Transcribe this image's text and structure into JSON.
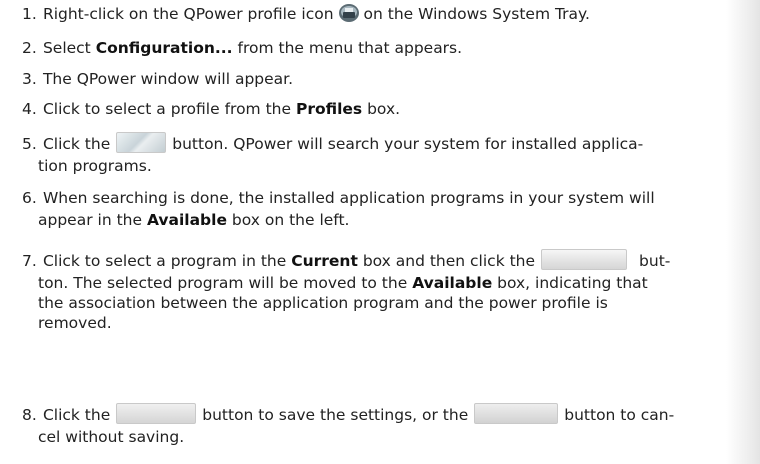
{
  "steps": [
    {
      "number": "1.",
      "before": "Right-click on the QPower profile icon",
      "after": "on the Windows System Tray.",
      "icon": "qpower-tray-icon"
    },
    {
      "number": "2.",
      "before": "Select",
      "bold": "Configuration...",
      "after": "from the menu that appears."
    },
    {
      "number": "3.",
      "text": "The QPower window will appear."
    },
    {
      "number": "4.",
      "before": "Click to select a profile from the",
      "bold": "Profiles",
      "after": "box."
    },
    {
      "number": "5.",
      "before": "Click the",
      "after": "button. QPower will search your system for installed applica-",
      "line2": "tion programs.",
      "icon": "search-button-icon"
    },
    {
      "number": "6.",
      "line1": "When searching is done, the installed application programs in your system will",
      "line2_before": "appear in the",
      "line2_bold": "Available",
      "line2_after": "box on the left."
    },
    {
      "number": "7.",
      "line1_before": "Click to select a program in the",
      "line1_bold": "Current",
      "line1_mid": "box and then click the",
      "line1_after": "but-",
      "line2_before": "ton. The selected program will be moved to the",
      "line2_bold": "Available",
      "line2_after": "box, indicating that",
      "line3": "the association between the application program and the power profile is",
      "line4": "removed.",
      "icon": "remove-button-icon"
    },
    {
      "number": "8.",
      "before": "Click the",
      "mid": "button to save the settings, or the",
      "after": "button to can-",
      "line2": "cel without saving.",
      "icons": [
        "ok-button-icon",
        "cancel-button-icon"
      ]
    }
  ]
}
